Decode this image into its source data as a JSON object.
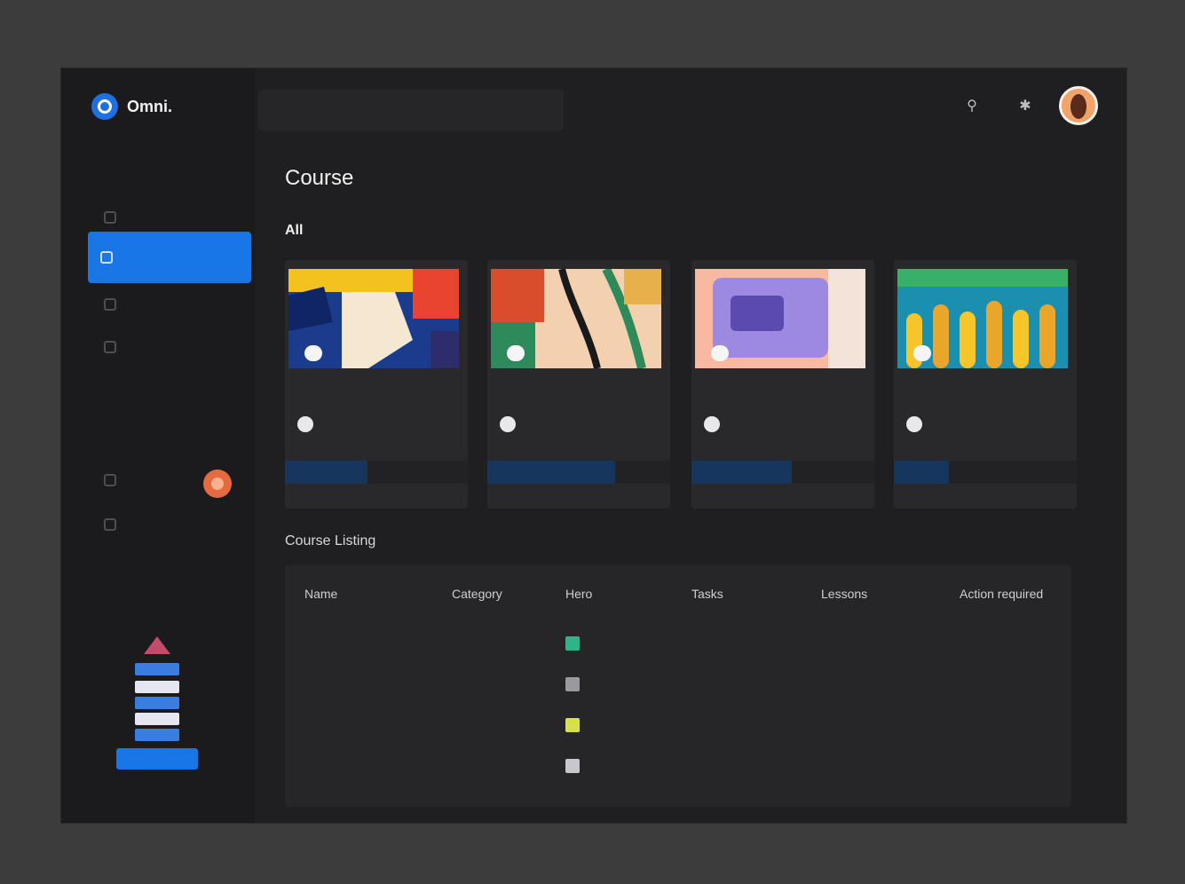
{
  "app": {
    "name": "Omni."
  },
  "sidebar": {
    "menu_label": "",
    "items": [
      {
        "label": ""
      },
      {
        "label": ""
      },
      {
        "label": ""
      },
      {
        "label": ""
      },
      {
        "label": ""
      }
    ],
    "section2_label": "",
    "items2": [
      {
        "label": ""
      },
      {
        "label": ""
      }
    ],
    "promo": {
      "title": "",
      "button": ""
    }
  },
  "search": {
    "placeholder": ""
  },
  "page": {
    "title": "Course"
  },
  "tabs": [
    {
      "label": "All"
    },
    {
      "label": ""
    },
    {
      "label": ""
    }
  ],
  "cards": [
    {
      "tag": "",
      "title": "",
      "author": "",
      "progress_label": "",
      "progress": 0.45,
      "image_colors": [
        "#f4c21e",
        "#1b3b8c",
        "#e8442f",
        "#f6e7d0"
      ]
    },
    {
      "tag": "",
      "title": "",
      "author": "",
      "progress_label": "",
      "progress": 0.7,
      "image_colors": [
        "#d94c2c",
        "#2e8a5a",
        "#f2d0b0",
        "#1a1a1a"
      ]
    },
    {
      "tag": "",
      "title": "",
      "author": "",
      "progress_label": "",
      "progress": 0.55,
      "image_colors": [
        "#f7b9a0",
        "#9d8ae0",
        "#5b4bb0",
        "#f3e3d9"
      ]
    },
    {
      "tag": "",
      "title": "",
      "author": "",
      "progress_label": "",
      "progress": 0.3,
      "image_colors": [
        "#1a8fb0",
        "#f5c52a",
        "#38b06a",
        "#e9a62a"
      ]
    }
  ],
  "listing": {
    "title": "Course Listing",
    "columns": [
      "Name",
      "Category",
      "Hero",
      "Tasks",
      "Lessons",
      "Action required"
    ],
    "rows": [
      {
        "icon_color": "#2fb38a"
      },
      {
        "icon_color": "#9a9a9e"
      },
      {
        "icon_color": "#d6e04a"
      },
      {
        "icon_color": "#c8c8cc"
      }
    ]
  },
  "colors": {
    "accent": "#1976e6",
    "background": "#1f1f21"
  }
}
